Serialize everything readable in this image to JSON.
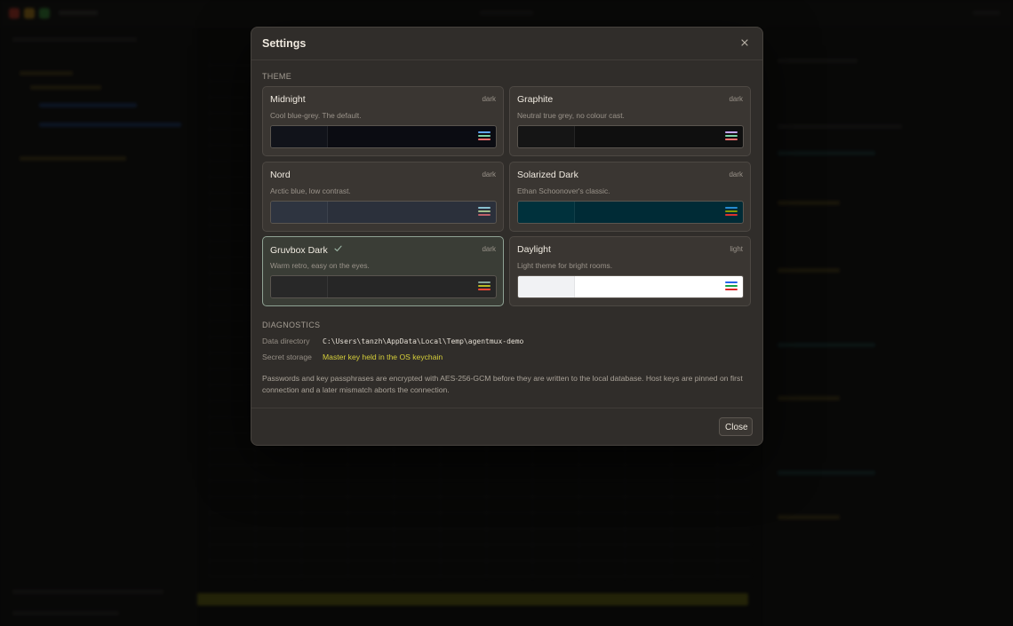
{
  "modal": {
    "title": "Settings",
    "theme_section_label": "THEME",
    "themes": [
      {
        "name": "Midnight",
        "mode": "dark",
        "description": "Cool blue-grey. The default.",
        "selected": false,
        "swatch": {
          "side": "#11131a",
          "main": "#0b0c12",
          "lines": [
            "#60a5fa",
            "#7dd3a8",
            "#f87171"
          ]
        }
      },
      {
        "name": "Graphite",
        "mode": "dark",
        "description": "Neutral true grey, no colour cast.",
        "selected": false,
        "swatch": {
          "side": "#151515",
          "main": "#0f0f0f",
          "lines": [
            "#c4a5f5",
            "#7dd3a8",
            "#f87171"
          ]
        }
      },
      {
        "name": "Nord",
        "mode": "dark",
        "description": "Arctic blue, low contrast.",
        "selected": false,
        "swatch": {
          "side": "#2e3440",
          "main": "#2b303b",
          "lines": [
            "#88c0d0",
            "#a3be8c",
            "#bf616a"
          ]
        }
      },
      {
        "name": "Solarized Dark",
        "mode": "dark",
        "description": "Ethan Schoonover's classic.",
        "selected": false,
        "swatch": {
          "side": "#00313c",
          "main": "#002b36",
          "lines": [
            "#268bd2",
            "#859900",
            "#dc322f"
          ]
        }
      },
      {
        "name": "Gruvbox Dark",
        "mode": "dark",
        "description": "Warm retro, easy on the eyes.",
        "selected": true,
        "swatch": {
          "side": "#282828",
          "main": "#262626",
          "lines": [
            "#83a598",
            "#b8bb26",
            "#fb4934"
          ]
        }
      },
      {
        "name": "Daylight",
        "mode": "light",
        "description": "Light theme for bright rooms.",
        "selected": false,
        "swatch": {
          "side": "#f1f2f4",
          "main": "#ffffff",
          "lines": [
            "#2563eb",
            "#16a34a",
            "#dc2626"
          ]
        }
      }
    ],
    "diagnostics_section_label": "DIAGNOSTICS",
    "diagnostics": {
      "data_directory_label": "Data directory",
      "data_directory_value": "C:\\Users\\tanzh\\AppData\\Local\\Temp\\agentmux-demo",
      "secret_storage_label": "Secret storage",
      "secret_storage_value": "Master key held in the OS keychain"
    },
    "info_text": "Passwords and key passphrases are encrypted with AES-256-GCM before they are written to the local database. Host keys are pinned on first connection and a later mismatch aborts the connection.",
    "close_button_label": "Close"
  },
  "colors": {
    "accent_yellow": "#d6cf3a",
    "selected_border": "#8fa294",
    "check": "#9fb8a8"
  },
  "icons": {
    "close": "close-icon",
    "selected": "check-icon"
  }
}
